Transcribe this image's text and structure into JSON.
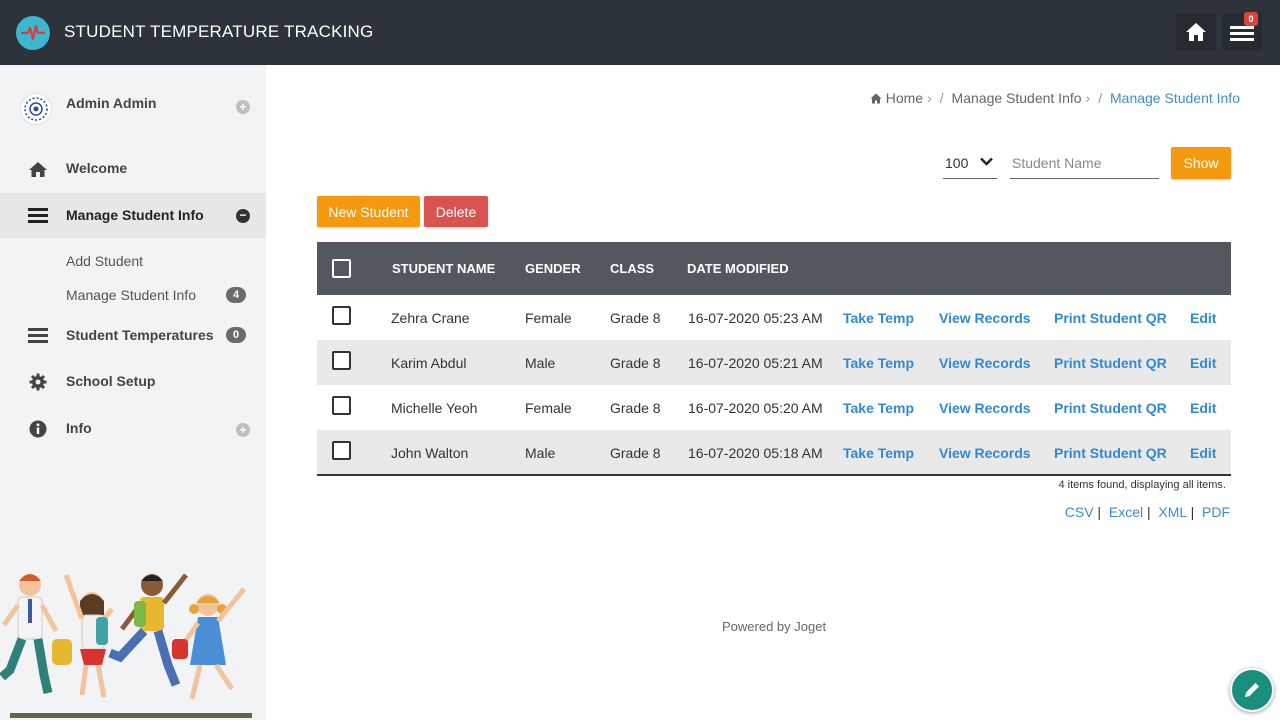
{
  "header": {
    "title": "STUDENT TEMPERATURE TRACKING",
    "notification_count": "0"
  },
  "sidebar": {
    "user_name": "Admin Admin",
    "items": [
      {
        "label": "Welcome",
        "icon": "home-icon"
      },
      {
        "label": "Manage Student Info",
        "icon": "list-icon"
      },
      {
        "label": "Student Temperatures",
        "icon": "list-icon",
        "badge": "0"
      },
      {
        "label": "School Setup",
        "icon": "gear-icon"
      },
      {
        "label": "Info",
        "icon": "info-icon"
      }
    ],
    "sub_items": [
      {
        "label": "Add Student"
      },
      {
        "label": "Manage Student Info",
        "badge": "4"
      }
    ]
  },
  "breadcrumb": {
    "home": "Home",
    "level1": "Manage Student Info",
    "current": "Manage Student Info"
  },
  "filters": {
    "page_size": "100",
    "search_placeholder": "Student Name",
    "show_label": "Show"
  },
  "actions": {
    "new_label": "New Student",
    "delete_label": "Delete"
  },
  "table": {
    "headers": {
      "name": "STUDENT NAME",
      "gender": "GENDER",
      "class": "CLASS",
      "date": "DATE MODIFIED"
    },
    "row_actions": {
      "take_temp": "Take Temp",
      "view_records": "View Records",
      "print_qr": "Print Student QR",
      "edit": "Edit"
    },
    "rows": [
      {
        "name": "Zehra Crane",
        "gender": "Female",
        "class": "Grade 8",
        "date": "16-07-2020 05:23 AM"
      },
      {
        "name": "Karim Abdul",
        "gender": "Male",
        "class": "Grade 8",
        "date": "16-07-2020 05:21 AM"
      },
      {
        "name": "Michelle Yeoh",
        "gender": "Female",
        "class": "Grade 8",
        "date": "16-07-2020 05:20 AM"
      },
      {
        "name": "John Walton",
        "gender": "Male",
        "class": "Grade 8",
        "date": "16-07-2020 05:18 AM"
      }
    ],
    "count_text": "4 items found, displaying all items."
  },
  "exports": {
    "csv": "CSV",
    "excel": "Excel",
    "xml": "XML",
    "pdf": "PDF"
  },
  "footer": {
    "text": "Powered by Joget"
  },
  "colors": {
    "header_bg": "#2d333b",
    "accent_orange": "#f5990f",
    "danger": "#d9534f",
    "link_blue": "#2f8ad6",
    "fab_green": "#1b8f7d"
  }
}
